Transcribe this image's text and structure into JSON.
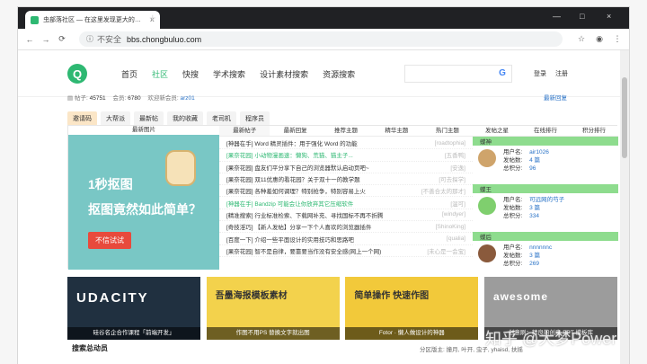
{
  "browser": {
    "tab_title": "虫部落社区 — 在这里发现更大的…",
    "close": "×",
    "new_tab": "+",
    "url_prefix": "不安全",
    "url": "bbs.chongbuluo.com",
    "window_controls": [
      "—",
      "□",
      "×"
    ]
  },
  "header": {
    "menu": [
      "首页",
      "社区",
      "快搜",
      "学术搜索",
      "设计素材搜索",
      "资源搜索"
    ],
    "active": "社区",
    "g_label": "G",
    "login": "登录",
    "register": "注册"
  },
  "stats": {
    "posts_label": "帖子",
    "posts": "45751",
    "members_label": "会员",
    "members": "6780",
    "newest_label": "欢迎新会员",
    "newest_member": "arz01",
    "latest_reply": "最新回复"
  },
  "chips": [
    "邀请码",
    "大帮派",
    "最新帖",
    "我的收藏",
    "老司机",
    "程序员"
  ],
  "left_card": {
    "header": "最新图片",
    "line1": "1秒抠图",
    "line2": "抠图竟然如此简单？",
    "button": "不信试试"
  },
  "middle_tabs": [
    "最新帖子",
    "最新回复",
    "推荐主题",
    "精华主题",
    "热门主题"
  ],
  "posts": [
    {
      "title": "[神器在手] Word 精灵插件：用于强化 Word 的功能",
      "meta": "[roadtophia]",
      "green": false
    },
    {
      "title": "[果奈花园] 小动物漫画速：懒狗、荒猫、猫主子...",
      "meta": "[五香鸭]",
      "green": true
    },
    {
      "title": "[果奈花园] 盘友们平分享下自己的浏览器默认启动页吧~",
      "meta": "[安逸]",
      "green": false
    },
    {
      "title": "[果奈花园] 双11优惠的看花园？关于双十一的教学题",
      "meta": "[可去探学]",
      "green": false
    },
    {
      "title": "[果奈花园] 各种羞如何调理？特别抢争，特别容易上火",
      "meta": "[不善合太的那才]",
      "green": false
    },
    {
      "title": "[神器在手] Bandzip 可能会让你放弃其它压缩软件",
      "meta": "[温可]",
      "green": true
    },
    {
      "title": "[精准搜索] 行业标准检索、下载网补充、寻找国标不再不折腾",
      "meta": "[windyer]",
      "green": false
    },
    {
      "title": "[奇技淫巧] 【新人发帖】分享一下个人喜欢的浏览器插件",
      "meta": "[ShinoKing]",
      "green": false
    },
    {
      "title": "[百度一下] 介绍一些平面设计的实用技巧和思路吧",
      "meta": "[qualia]",
      "green": false
    },
    {
      "title": "[果奈花园] 智不是自律，要靠要当作没有安全感(网上一个网)",
      "meta": "[未心是一会宝]",
      "green": false
    }
  ],
  "right": {
    "tabs": [
      "发帖之星",
      "在线排行",
      "积分排行"
    ],
    "groups": [
      {
        "title": "蝶神",
        "user": "air1026",
        "posts": "4 篇",
        "score": "96"
      },
      {
        "title": "蝶王",
        "user": "可远网的芍子",
        "posts": "3 篇",
        "score": "334"
      },
      {
        "title": "蝶后",
        "user": "nnnnnnc",
        "posts": "3 篇",
        "score": "269"
      }
    ],
    "labels": {
      "user": "用户名",
      "posts": "发帖数",
      "score": "总积分"
    }
  },
  "thumbs": [
    {
      "caption": "硅谷名企合作课程「前端开发」",
      "title": "UDACITY",
      "color": "#203040"
    },
    {
      "caption": "作图不用PS 替换文字就出图",
      "title": "吾墨海报模板素材",
      "color": "#f3d24c"
    },
    {
      "caption": "Fotor · 懒人做设计的神器",
      "title": "简单操作 快速作图",
      "color": "#f2c93a"
    },
    {
      "caption": "创意刷：精良的创意 PPT 模板库",
      "title": "awesome",
      "color": "#9c9c9c"
    }
  ],
  "footer": {
    "title": "搜索总动员",
    "right": "分区版主: 撞月, 叶开, 虫子, yhaisd, 扶摇"
  },
  "watermark": "知乎 @大梦Power"
}
